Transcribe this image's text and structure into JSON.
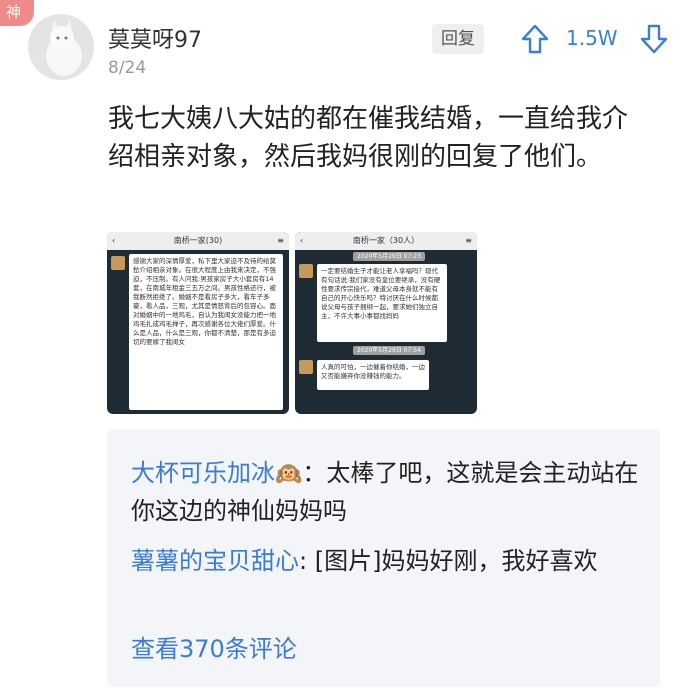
{
  "badge": {
    "label": "神"
  },
  "author": {
    "name": "莫莫呀97",
    "date": "8/24"
  },
  "actions": {
    "reply_label": "回复",
    "vote_count": "1.5W"
  },
  "post": {
    "text": "我七大姨八大姑的都在催我结婚，一直给我介绍相亲对象，然后我妈很刚的回复了他们。"
  },
  "images": [
    {
      "title": "南桥一家(30)",
      "message": "感谢大家的深情厚爱，私下里大家迫不及待的给莫愁介绍相亲对象。在很大程度上由我来决定，不强迫，不压制。有人问我:男孩家房子大小套房有14套，在南城年租金三五万之间。男孩性格还行，被我断然拒绝了。婚姻不是看房子多大，看车子多豪，看人品，三观，尤其是情怒背后的包容心。面对婚姻中的一地鸡毛，自认为我闺女没能力把一地鸡毛扎成鸡毛掸子，再次感谢各位大佬们厚爱。什么是人品，什么是三观，你都不清楚，那是有多迫切的要嫁了我闺女"
    },
    {
      "title": "南桥一家（30人）",
      "message_1": "一定要结婚生子才能让老人享福吗？现代有句话说:我们家没有皇位要继承，没有硬性要求传宗接代，难道父母本身就不能有自己的开心快乐吗？特讨厌在什么时候都说父母与孩子捆绑一起，要求她们独立自主，不许大事小事都找妈妈",
      "message_2": "人真的可怕，一边催着你结婚，一边又否能嫌弃你没赚钱的能力。",
      "time_1": "2020年5月29日 07:23",
      "time_2": "2020年5月29日 07:54"
    }
  ],
  "comments": [
    {
      "user": "大杯可乐加冰",
      "emoji": "🙉",
      "sep": "：",
      "text": "太棒了吧，这就是会主动站在你这边的神仙妈妈吗"
    },
    {
      "user": "薯薯的宝贝甜心",
      "sep": ": ",
      "text": "[图片]妈妈好刚，我好喜欢"
    }
  ],
  "view_more": "查看370条评论",
  "colors": {
    "link_blue": "#3a7bd5",
    "vote_blue": "#3d7fd1",
    "badge_red": "#f08a8a"
  }
}
